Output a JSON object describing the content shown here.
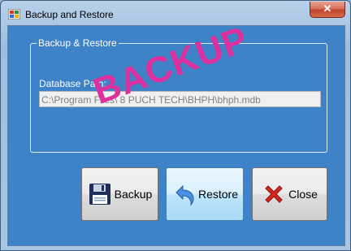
{
  "window": {
    "title": "Backup and Restore",
    "close_glyph": "✕"
  },
  "group": {
    "title": "Backup & Restore",
    "db_label": "Database Path:",
    "db_path": "C:\\Program Files\\ 8 PUCH TECH\\BHPH\\bhph.mdb"
  },
  "watermark": "BACKUP",
  "buttons": {
    "backup": "Backup",
    "restore": "Restore",
    "close": "Close"
  },
  "icons": {
    "app": "app-icon",
    "backup": "floppy-disk-icon",
    "restore": "undo-arrow-icon",
    "close": "red-x-icon"
  },
  "colors": {
    "client_background": "#3e82c7",
    "watermark": "#de2f9e",
    "close_button": "#c0432b"
  }
}
